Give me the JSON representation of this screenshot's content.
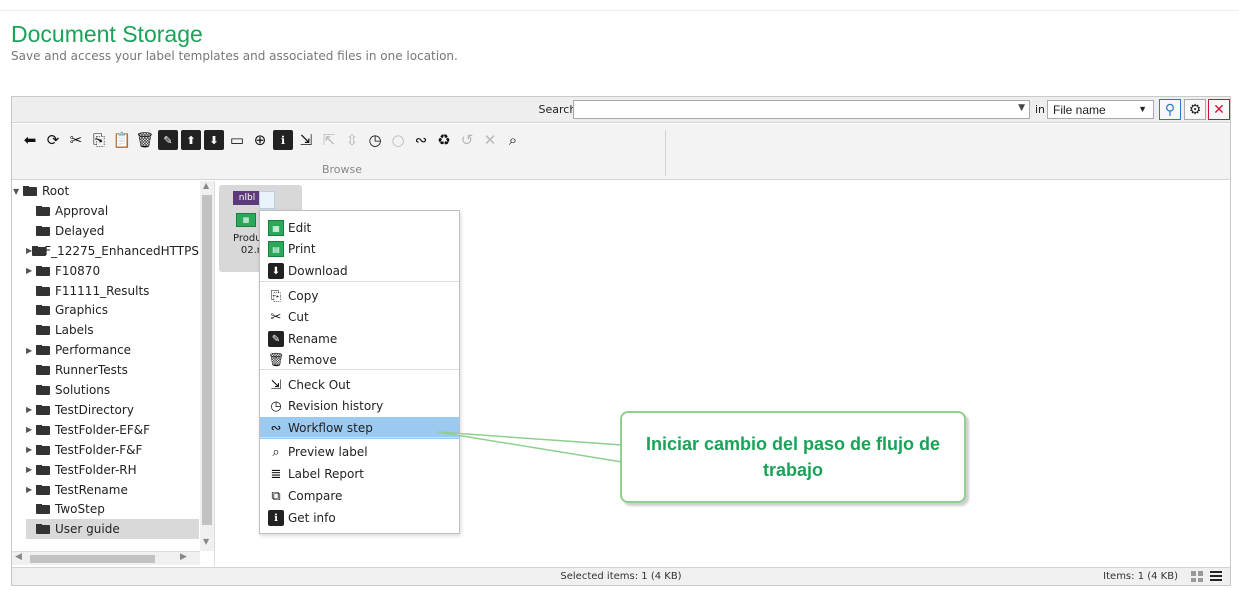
{
  "header": {
    "title": "Document Storage",
    "subtitle": "Save and access your label templates and associated files in one location."
  },
  "search": {
    "label": "Search:",
    "value": "",
    "in_label": "in",
    "field": "File name"
  },
  "toolbar": {
    "group_caption": "Browse",
    "tools": [
      {
        "icon": "back-arrow-icon",
        "glyph": "⬅",
        "enabled": true
      },
      {
        "icon": "refresh-icon",
        "glyph": "⟳",
        "enabled": true
      },
      {
        "icon": "cut-icon",
        "glyph": "✂",
        "enabled": true
      },
      {
        "icon": "copy-icon",
        "glyph": "⎘",
        "enabled": true
      },
      {
        "icon": "paste-icon",
        "glyph": "📋",
        "enabled": false
      },
      {
        "icon": "delete-icon",
        "glyph": "🗑",
        "enabled": true
      },
      {
        "icon": "rename-icon",
        "glyph": "✎",
        "enabled": true
      },
      {
        "icon": "upload-icon",
        "glyph": "⬆",
        "enabled": true
      },
      {
        "icon": "download-icon",
        "glyph": "⬇",
        "enabled": true
      },
      {
        "icon": "new-folder-icon",
        "glyph": "▭",
        "enabled": true
      },
      {
        "icon": "add-file-icon",
        "glyph": "⊕",
        "enabled": true
      },
      {
        "icon": "info-icon",
        "glyph": "ℹ",
        "enabled": true
      },
      {
        "icon": "check-out-icon",
        "glyph": "⇲",
        "enabled": true
      },
      {
        "icon": "check-in-icon",
        "glyph": "⇱",
        "enabled": false
      },
      {
        "icon": "undo-checkout-icon",
        "glyph": "⇳",
        "enabled": false
      },
      {
        "icon": "revision-history-icon",
        "glyph": "◷",
        "enabled": true
      },
      {
        "icon": "sync-icon",
        "glyph": "○",
        "enabled": false
      },
      {
        "icon": "workflow-icon",
        "glyph": "∾",
        "enabled": true
      },
      {
        "icon": "recycle-bin-icon",
        "glyph": "♻",
        "enabled": true
      },
      {
        "icon": "restore-icon",
        "glyph": "↺",
        "enabled": false
      },
      {
        "icon": "purge-icon",
        "glyph": "✕",
        "enabled": false
      },
      {
        "icon": "preview-icon",
        "glyph": "⌕",
        "enabled": true
      }
    ]
  },
  "tree": {
    "items": [
      {
        "label": "Root",
        "level": 0,
        "expander": "▼",
        "selected": false
      },
      {
        "label": "Approval",
        "level": 1,
        "expander": "",
        "selected": false
      },
      {
        "label": "Delayed",
        "level": 1,
        "expander": "",
        "selected": false
      },
      {
        "label": "F_12275_EnhancedHTTPS",
        "level": 1,
        "expander": "▶",
        "selected": false
      },
      {
        "label": "F10870",
        "level": 1,
        "expander": "▶",
        "selected": false
      },
      {
        "label": "F11111_Results",
        "level": 1,
        "expander": "",
        "selected": false
      },
      {
        "label": "Graphics",
        "level": 1,
        "expander": "",
        "selected": false
      },
      {
        "label": "Labels",
        "level": 1,
        "expander": "",
        "selected": false
      },
      {
        "label": "Performance",
        "level": 1,
        "expander": "▶",
        "selected": false
      },
      {
        "label": "RunnerTests",
        "level": 1,
        "expander": "",
        "selected": false
      },
      {
        "label": "Solutions",
        "level": 1,
        "expander": "",
        "selected": false
      },
      {
        "label": "TestDirectory",
        "level": 1,
        "expander": "▶",
        "selected": false
      },
      {
        "label": "TestFolder-EF&F",
        "level": 1,
        "expander": "▶",
        "selected": false
      },
      {
        "label": "TestFolder-F&F",
        "level": 1,
        "expander": "▶",
        "selected": false
      },
      {
        "label": "TestFolder-RH",
        "level": 1,
        "expander": "▶",
        "selected": false
      },
      {
        "label": "TestRename",
        "level": 1,
        "expander": "▶",
        "selected": false
      },
      {
        "label": "TwoStep",
        "level": 1,
        "expander": "",
        "selected": false
      },
      {
        "label": "User guide",
        "level": 1,
        "expander": "",
        "selected": true
      }
    ]
  },
  "file": {
    "tag": "nlbl",
    "name_line1": "Product",
    "name_line2": "02.n"
  },
  "context_menu": {
    "items": [
      {
        "label": "Edit",
        "icon": "edit-label-icon"
      },
      {
        "label": "Print",
        "icon": "print-label-icon"
      },
      {
        "label": "Download",
        "icon": "download-icon"
      },
      {
        "label": "Copy",
        "icon": "copy-icon"
      },
      {
        "label": "Cut",
        "icon": "cut-icon"
      },
      {
        "label": "Rename",
        "icon": "rename-icon"
      },
      {
        "label": "Remove",
        "icon": "delete-icon"
      },
      {
        "label": "Check Out",
        "icon": "check-out-icon"
      },
      {
        "label": "Revision history",
        "icon": "revision-history-icon"
      },
      {
        "label": "Workflow step",
        "icon": "workflow-icon"
      },
      {
        "label": "Preview label",
        "icon": "preview-icon"
      },
      {
        "label": "Label Report",
        "icon": "report-icon"
      },
      {
        "label": "Compare",
        "icon": "compare-icon"
      },
      {
        "label": "Get info",
        "icon": "info-icon"
      }
    ]
  },
  "status": {
    "selected": "Selected items: 1 (4 KB)",
    "items": "Items: 1 (4 KB)"
  },
  "callout": {
    "text": "Iniciar cambio del paso de flujo de trabajo"
  },
  "colors": {
    "brand_green": "#1aa358",
    "highlight": "#9cc9ef",
    "close_red": "#d0103a",
    "search_blue": "#2a76d2"
  }
}
